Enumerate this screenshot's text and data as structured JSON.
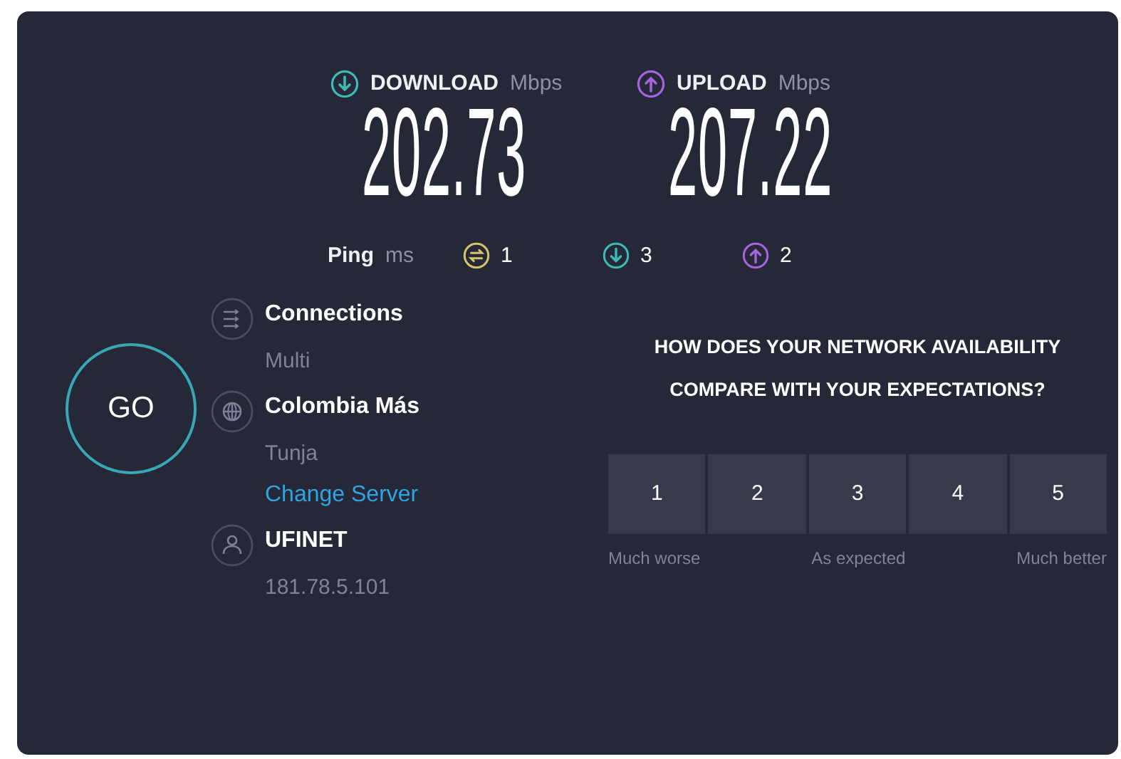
{
  "download": {
    "label": "DOWNLOAD",
    "unit": "Mbps",
    "value": "202.73"
  },
  "upload": {
    "label": "UPLOAD",
    "unit": "Mbps",
    "value": "207.22"
  },
  "ping": {
    "label": "Ping",
    "unit": "ms",
    "values": [
      {
        "kind": "idle",
        "value": "1"
      },
      {
        "kind": "download",
        "value": "3"
      },
      {
        "kind": "upload",
        "value": "2"
      }
    ]
  },
  "go_button": "GO",
  "details": [
    {
      "kind": "connections",
      "title": "Connections",
      "subtitle": "Multi"
    },
    {
      "kind": "server",
      "title": "Colombia Más",
      "subtitle": "Tunja",
      "link": "Change Server"
    },
    {
      "kind": "provider",
      "title": "UFINET",
      "subtitle": "181.78.5.101"
    }
  ],
  "survey": {
    "question_lines": [
      "HOW DOES YOUR NETWORK AVAILABILITY",
      "COMPARE WITH YOUR EXPECTATIONS?"
    ],
    "options": [
      "1",
      "2",
      "3",
      "4",
      "5"
    ],
    "scale_labels": [
      "Much worse",
      "As expected",
      "Much better"
    ]
  }
}
